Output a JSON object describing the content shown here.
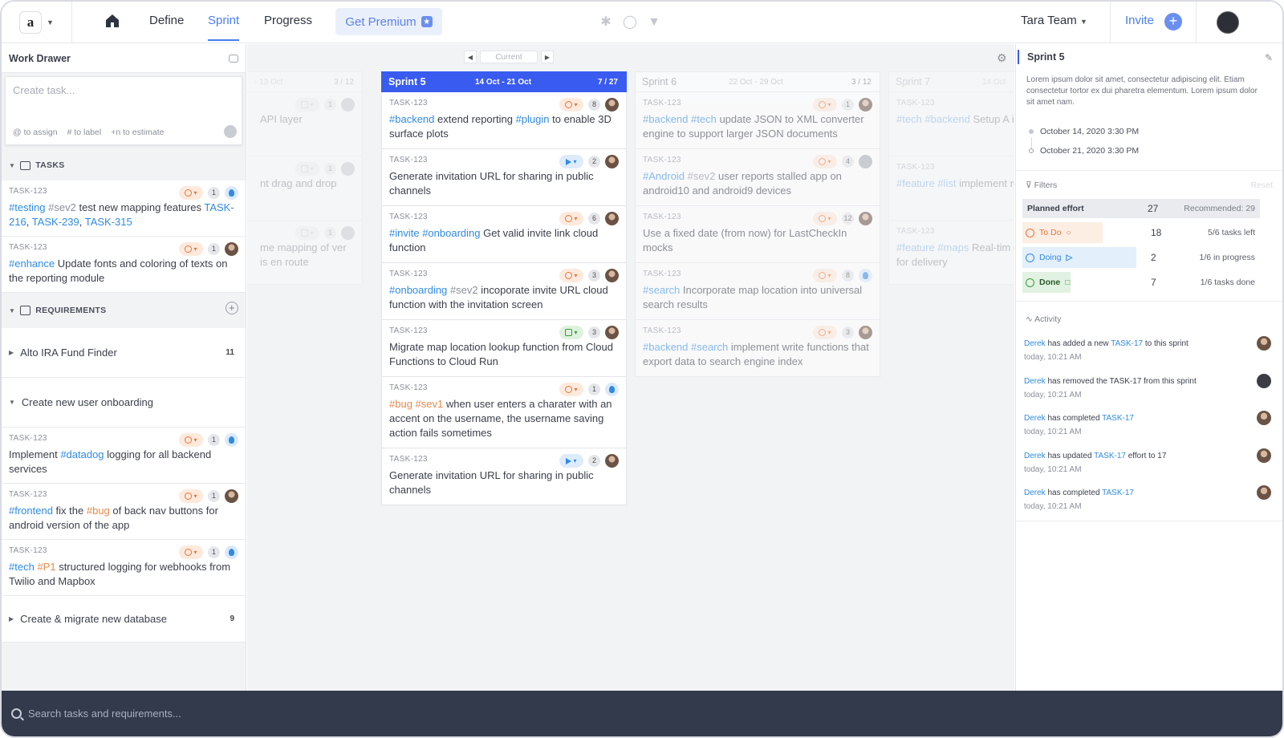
{
  "nav": {
    "logo": "a",
    "tabs": [
      "Define",
      "Sprint",
      "Progress"
    ],
    "active_tab": "Sprint",
    "premium": "Get Premium",
    "team": "Tara Team",
    "invite": "Invite",
    "integrations": [
      "slack-icon",
      "github-icon",
      "gitlab-icon"
    ]
  },
  "drawer": {
    "title": "Work Drawer",
    "create_placeholder": "Create task...",
    "hints": [
      "@ to assign",
      "# to label",
      "+n to estimate"
    ],
    "tasks_label": "TASKS",
    "tasks": [
      {
        "id": "TASK-123",
        "parts": [
          [
            "#testing",
            "tag"
          ],
          [
            " ",
            ""
          ],
          [
            "#sev2",
            "tag3"
          ],
          [
            " test new mapping features ",
            ""
          ],
          [
            "TASK-216",
            "tag"
          ],
          [
            ", ",
            ""
          ],
          [
            "TASK-239",
            "tag"
          ],
          [
            ", ",
            ""
          ],
          [
            "TASK-315",
            "tag"
          ]
        ],
        "status": "todo",
        "count": "1",
        "avatar": "blue"
      },
      {
        "id": "TASK-123",
        "parts": [
          [
            "#enhance",
            "tag"
          ],
          [
            " Update fonts and coloring of texts on the reporting module",
            ""
          ]
        ],
        "status": "todo",
        "count": "1",
        "avatar": "photo"
      }
    ],
    "requirements_label": "REQUIREMENTS",
    "requirements": [
      {
        "name": "Alto IRA Fund Finder",
        "count": "11",
        "expanded": false
      },
      {
        "name": "Create new user onboarding",
        "count": "",
        "expanded": true
      }
    ],
    "req_tasks": [
      {
        "id": "TASK-123",
        "parts": [
          [
            "Implement ",
            ""
          ],
          [
            "#datadog",
            "tag"
          ],
          [
            " logging for all backend services",
            ""
          ]
        ],
        "status": "todo",
        "count": "1",
        "avatar": "blue"
      },
      {
        "id": "TASK-123",
        "parts": [
          [
            "#frontend",
            "tag"
          ],
          [
            " fix the ",
            ""
          ],
          [
            "#bug",
            "tag2"
          ],
          [
            " of back nav buttons for android version of the app",
            ""
          ]
        ],
        "status": "todo",
        "count": "1",
        "avatar": "photo"
      },
      {
        "id": "TASK-123",
        "parts": [
          [
            "#tech",
            "tag"
          ],
          [
            " ",
            ""
          ],
          [
            "#P1",
            "tag2"
          ],
          [
            " structured logging for webhooks from Twilio and Mapbox",
            ""
          ]
        ],
        "status": "todo",
        "count": "1",
        "avatar": "blue"
      }
    ],
    "last_requirement": {
      "name": "Create & migrate new database",
      "count": "9"
    }
  },
  "board": {
    "current_label": "Current",
    "columns": [
      {
        "name": "",
        "dates": "- 13 Oct",
        "count": "3 / 12",
        "state": "faded",
        "cards": [
          {
            "id": "",
            "text": "API layer",
            "status": "gray",
            "count": "1",
            "avatar": "gray"
          },
          {
            "id": "",
            "text": "nt drag and drop",
            "status": "gray",
            "count": "1",
            "avatar": "gray"
          },
          {
            "id": "",
            "text": "me mapping of ver is en route",
            "status": "gray",
            "count": "1",
            "avatar": "gray"
          }
        ]
      },
      {
        "name": "Sprint 5",
        "dates": "14 Oct - 21 Oct",
        "count": "7 / 27",
        "state": "active",
        "cards": [
          {
            "id": "TASK-123",
            "parts": [
              [
                "#backend",
                "tag"
              ],
              [
                " extend reporting ",
                ""
              ],
              [
                "#plugin",
                "tag"
              ],
              [
                " to enable 3D surface plots",
                ""
              ]
            ],
            "status": "todo",
            "count": "8",
            "avatar": "photo"
          },
          {
            "id": "TASK-123",
            "parts": [
              [
                "Generate invitation URL for sharing in public channels",
                ""
              ]
            ],
            "status": "play",
            "count": "2",
            "avatar": "photo"
          },
          {
            "id": "TASK-123",
            "parts": [
              [
                "#invite",
                "tag"
              ],
              [
                " ",
                ""
              ],
              [
                "#onboarding",
                "tag"
              ],
              [
                " Get valid invite link  cloud function",
                ""
              ]
            ],
            "status": "todo",
            "count": "6",
            "avatar": "photo"
          },
          {
            "id": "TASK-123",
            "parts": [
              [
                "#onboarding",
                "tag"
              ],
              [
                " ",
                ""
              ],
              [
                "#sev2",
                "tag3"
              ],
              [
                " incoporate invite URL cloud function with the invitation screen",
                ""
              ]
            ],
            "status": "todo",
            "count": "3",
            "avatar": "photo"
          },
          {
            "id": "TASK-123",
            "parts": [
              [
                "Migrate map location lookup function from Cloud Functions to Cloud Run",
                ""
              ]
            ],
            "status": "done",
            "count": "3",
            "avatar": "photo"
          },
          {
            "id": "TASK-123",
            "parts": [
              [
                "#bug",
                "tag2"
              ],
              [
                " ",
                ""
              ],
              [
                "#sev1",
                "tag2"
              ],
              [
                " when user enters a charater with an accent on the username, the username saving action fails sometimes",
                ""
              ]
            ],
            "status": "todo",
            "count": "1",
            "avatar": "blue"
          },
          {
            "id": "TASK-123",
            "parts": [
              [
                "Generate invitation URL for sharing in public channels",
                ""
              ]
            ],
            "status": "play",
            "count": "2",
            "avatar": "photo"
          }
        ]
      },
      {
        "name": "Sprint 6",
        "dates": "22 Oct - 29 Oct",
        "count": "3 / 12",
        "state": "dim",
        "cards": [
          {
            "id": "TASK-123",
            "parts": [
              [
                "#backend",
                "tag"
              ],
              [
                " ",
                ""
              ],
              [
                "#tech",
                "tag"
              ],
              [
                " update JSON to XML converter engine to support larger JSON documents",
                ""
              ]
            ],
            "status": "todo",
            "count": "1",
            "avatar": "photo"
          },
          {
            "id": "TASK-123",
            "parts": [
              [
                "#Android",
                "tag"
              ],
              [
                " ",
                ""
              ],
              [
                "#sev2",
                "tag3"
              ],
              [
                " user reports stalled app on android10 and android9 devices",
                ""
              ]
            ],
            "status": "todo",
            "count": "4",
            "avatar": "gray"
          },
          {
            "id": "TASK-123",
            "parts": [
              [
                "Use a fixed date (from now) for LastCheckIn mocks",
                ""
              ]
            ],
            "status": "todo",
            "count": "12",
            "avatar": "photo"
          },
          {
            "id": "TASK-123",
            "parts": [
              [
                "#search",
                "tag"
              ],
              [
                " Incorporate map location into universal search results",
                ""
              ]
            ],
            "status": "todo",
            "count": "8",
            "avatar": "blue"
          },
          {
            "id": "TASK-123",
            "parts": [
              [
                "#backend",
                "tag"
              ],
              [
                " ",
                ""
              ],
              [
                "#search",
                "tag"
              ],
              [
                " implement write functions that export data to search engine index",
                ""
              ]
            ],
            "status": "todo",
            "count": "3",
            "avatar": "photo"
          }
        ]
      },
      {
        "name": "Sprint 7",
        "dates": "14 Oct",
        "count": "",
        "state": "faded",
        "cards": [
          {
            "id": "TASK-123",
            "parts": [
              [
                "#tech",
                "tag"
              ],
              [
                " ",
                ""
              ],
              [
                "#backend",
                "tag"
              ],
              [
                " Setup A infrastructure for #auth li",
                ""
              ]
            ],
            "status": "",
            "count": "",
            "avatar": ""
          },
          {
            "id": "TASK-123",
            "parts": [
              [
                "#feature",
                "tag"
              ],
              [
                " ",
                ""
              ],
              [
                "#list",
                "tag"
              ],
              [
                " implement reording of list items",
                ""
              ]
            ],
            "status": "",
            "count": "",
            "avatar": ""
          },
          {
            "id": "TASK-123",
            "parts": [
              [
                "#feature",
                "tag"
              ],
              [
                " ",
                ""
              ],
              [
                "#maps",
                "tag"
              ],
              [
                " Real-tim driver location while driv for delivery",
                ""
              ]
            ],
            "status": "",
            "count": "",
            "avatar": ""
          }
        ]
      }
    ]
  },
  "sprint_panel": {
    "title": "Sprint 5",
    "description": "Lorem ipsum dolor sit amet, consectetur adipiscing elit. Etiam consectetur tortor ex dui pharetra elementum. Lorem ipsum dolor sit amet nam.",
    "start": "October 14, 2020 3:30 PM",
    "end": "October 21, 2020 3:30 PM",
    "filters_label": "Filters",
    "reset": "Reset",
    "planned_label": "Planned effort",
    "planned_value": "27",
    "recommended": "Recommended: 29",
    "statuses": [
      {
        "label": "To Do",
        "value": "18",
        "note": "5/6 tasks left",
        "color": "#e8743c",
        "bg": "#fdeee4"
      },
      {
        "label": "Doing",
        "value": "2",
        "note": "1/6 in progress",
        "color": "#2f8be3",
        "bg": "#e3effb"
      },
      {
        "label": "Done",
        "value": "7",
        "note": "1/6 tasks done",
        "color": "#3a9a3a",
        "bg": "#e2f2e2"
      }
    ],
    "activity_label": "Activity",
    "activity": [
      {
        "who": "Derek",
        "pre": " has added a new ",
        "task": "TASK-17",
        "post": " to this sprint",
        "when": "today, 10:21 AM",
        "avatar": "photo"
      },
      {
        "who": "Derek",
        "pre": " has removed the TASK-17 from this sprint",
        "task": "",
        "post": "",
        "when": "today, 10:21 AM",
        "avatar": "dark"
      },
      {
        "who": "Derek",
        "pre": " has completed ",
        "task": "TASK-17",
        "post": "",
        "when": "today, 10:21 AM",
        "avatar": "photo"
      },
      {
        "who": "Derek",
        "pre": " has updated ",
        "task": "TASK-17",
        "post": " effort to 17",
        "when": "today, 10:21 AM",
        "avatar": "photo"
      },
      {
        "who": "Derek",
        "pre": " has completed ",
        "task": "TASK-17",
        "post": "",
        "when": "today, 10:21 AM",
        "avatar": "photo"
      }
    ]
  },
  "search": {
    "placeholder": "Search tasks and requirements..."
  }
}
